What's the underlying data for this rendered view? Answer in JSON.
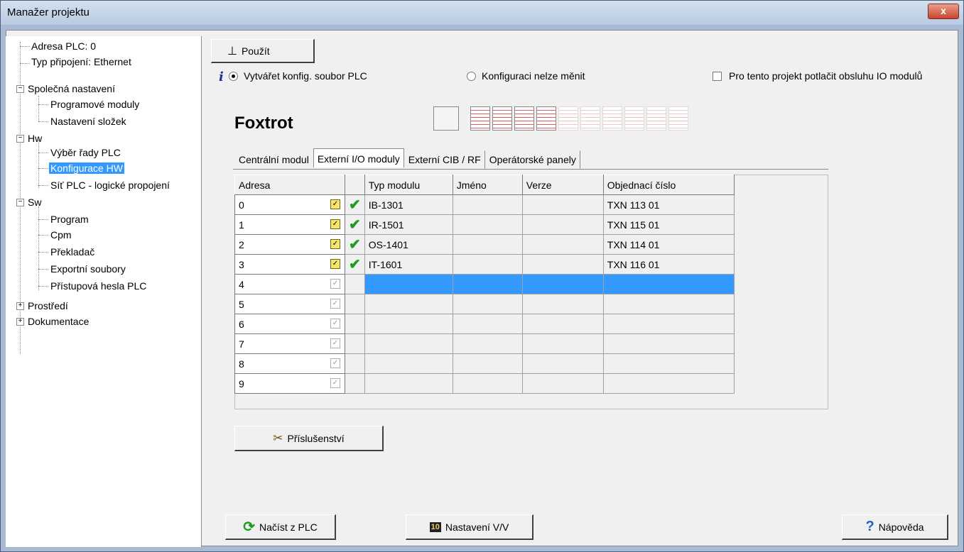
{
  "window": {
    "title": "Manažer projektu",
    "close_glyph": "x"
  },
  "tree": {
    "items": [
      {
        "label": "Adresa PLC: 0"
      },
      {
        "label": "Typ připojení: Ethernet"
      },
      {
        "label": "Společná nastavení"
      },
      {
        "label": "Programové moduly"
      },
      {
        "label": "Nastavení složek"
      },
      {
        "label": "Hw"
      },
      {
        "label": "Výběr řady PLC"
      },
      {
        "label": "Konfigurace HW"
      },
      {
        "label": "Síť PLC - logické propojení"
      },
      {
        "label": "Sw"
      },
      {
        "label": "Program"
      },
      {
        "label": "Cpm"
      },
      {
        "label": "Překladač"
      },
      {
        "label": "Exportní soubory"
      },
      {
        "label": "Přístupová hesla PLC"
      },
      {
        "label": "Prostředí"
      },
      {
        "label": "Dokumentace"
      }
    ],
    "collapse_glyph": "−",
    "expand_glyph": "+"
  },
  "toolbar": {
    "apply_label": "Použít",
    "apply_icon": "⊥"
  },
  "options": {
    "info_icon": "i",
    "radio_create": "Vytvářet konfig. soubor PLC",
    "radio_locked": "Konfiguraci nelze měnit",
    "suppress_io": "Pro tento projekt potlačit obsluhu IO modulů"
  },
  "heading": "Foxtrot",
  "tabs": [
    "Centrální modul",
    "Externí I/O moduly",
    "Externí CIB / RF",
    "Operátorské panely"
  ],
  "table": {
    "headers": [
      "Adresa",
      "",
      "Typ modulu",
      "Jméno",
      "Verze",
      "Objednací číslo"
    ],
    "rows": [
      {
        "addr": "0",
        "type": "IB-1301",
        "name": "",
        "ver": "",
        "order": "TXN 113 01"
      },
      {
        "addr": "1",
        "type": "IR-1501",
        "name": "",
        "ver": "",
        "order": "TXN 115 01"
      },
      {
        "addr": "2",
        "type": "OS-1401",
        "name": "",
        "ver": "",
        "order": "TXN 114 01"
      },
      {
        "addr": "3",
        "type": "IT-1601",
        "name": "",
        "ver": "",
        "order": "TXN 116 01"
      },
      {
        "addr": "4",
        "type": "",
        "name": "",
        "ver": "",
        "order": ""
      },
      {
        "addr": "5",
        "type": "",
        "name": "",
        "ver": "",
        "order": ""
      },
      {
        "addr": "6",
        "type": "",
        "name": "",
        "ver": "",
        "order": ""
      },
      {
        "addr": "7",
        "type": "",
        "name": "",
        "ver": "",
        "order": ""
      },
      {
        "addr": "8",
        "type": "",
        "name": "",
        "ver": "",
        "order": ""
      },
      {
        "addr": "9",
        "type": "",
        "name": "",
        "ver": "",
        "order": ""
      }
    ],
    "check_glyph": "✔",
    "cfg_glyph": "✓"
  },
  "buttons": {
    "accessories": "Příslušenství",
    "accessories_icon": "✂",
    "load": "Načíst z PLC",
    "load_icon": "⟳",
    "io_settings": "Nastavení V/V",
    "io_icon": "10",
    "help": "Nápověda",
    "help_icon": "?"
  }
}
